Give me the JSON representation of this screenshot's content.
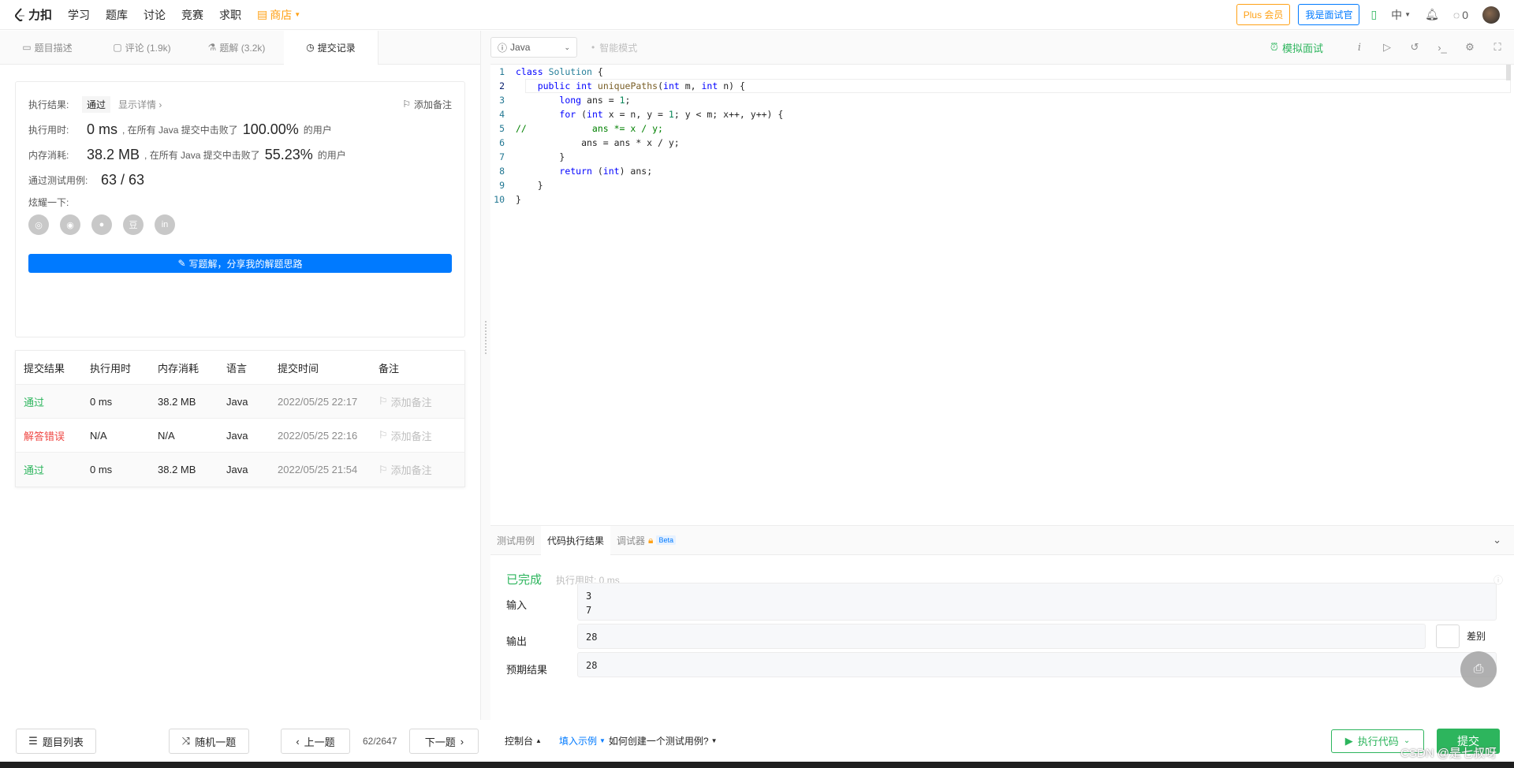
{
  "nav": {
    "logo": "力扣",
    "links": [
      "学习",
      "题库",
      "讨论",
      "竞赛",
      "求职"
    ],
    "store": "商店",
    "plus": "Plus 会员",
    "interviewer": "我是面试官",
    "lang": "中",
    "streak": "0"
  },
  "left_tabs": [
    {
      "label": "题目描述",
      "icon": "doc-icon"
    },
    {
      "label": "评论 (1.9k)",
      "icon": "comment-icon"
    },
    {
      "label": "题解 (3.2k)",
      "icon": "flask-icon"
    },
    {
      "label": "提交记录",
      "icon": "clock-icon"
    }
  ],
  "result": {
    "result_label": "执行结果:",
    "result_value": "通过",
    "show_detail": "显示详情 ›",
    "add_note": "添加备注",
    "time_label": "执行用时:",
    "time_value": "0 ms",
    "time_mid": ", 在所有 Java 提交中击败了",
    "time_pct": "100.00%",
    "users": "的用户",
    "mem_label": "内存消耗:",
    "mem_value": "38.2 MB",
    "mem_mid": ", 在所有 Java 提交中击败了",
    "mem_pct": "55.23%",
    "tests_label": "通过测试用例:",
    "tests_value": "63 / 63",
    "share_label": "炫耀一下:",
    "write_btn": "写题解，分享我的解题思路"
  },
  "submissions": {
    "headers": [
      "提交结果",
      "执行用时",
      "内存消耗",
      "语言",
      "提交时间",
      "备注"
    ],
    "rows": [
      {
        "status": "通过",
        "time": "0 ms",
        "mem": "38.2 MB",
        "lang": "Java",
        "date": "2022/05/25 22:17",
        "note": "添加备注"
      },
      {
        "status": "解答错误",
        "time": "N/A",
        "mem": "N/A",
        "lang": "Java",
        "date": "2022/05/25 22:16",
        "note": "添加备注"
      },
      {
        "status": "通过",
        "time": "0 ms",
        "mem": "38.2 MB",
        "lang": "Java",
        "date": "2022/05/25 21:54",
        "note": "添加备注"
      }
    ]
  },
  "left_bottom": {
    "list": "题目列表",
    "random": "随机一题",
    "prev": "上一题",
    "page": "62/2647",
    "next": "下一题"
  },
  "editor_header": {
    "language": "Java",
    "smart_mode": "智能模式",
    "mock": "模拟面试"
  },
  "code_lines": [
    "class Solution {",
    "    public int uniquePaths(int m, int n) {",
    "        long ans = 1;",
    "        for (int x = n, y = 1; y < m; x++, y++) {",
    "//            ans *= x / y;",
    "            ans = ans * x / y;",
    "        }",
    "        return (int) ans;",
    "    }",
    "}"
  ],
  "console": {
    "tabs": [
      "测试用例",
      "代码执行结果",
      "调试器"
    ],
    "beta": "Beta",
    "done": "已完成",
    "exec_time": "执行用时: 0 ms",
    "input_label": "输入",
    "input_value": "3\n7",
    "output_label": "输出",
    "output_value": "28",
    "diff_label": "差别",
    "expected_label": "预期结果",
    "expected_value": "28"
  },
  "right_bottom": {
    "console": "控制台",
    "fill_example": "填入示例",
    "how_create": "如何创建一个测试用例?",
    "run": "执行代码",
    "submit": "提交"
  },
  "watermark": "CSDN @是七叔呀",
  "colors": {
    "accent": "#007aff",
    "success": "#2db55d",
    "error": "#ef4743",
    "store": "#ffa116"
  }
}
